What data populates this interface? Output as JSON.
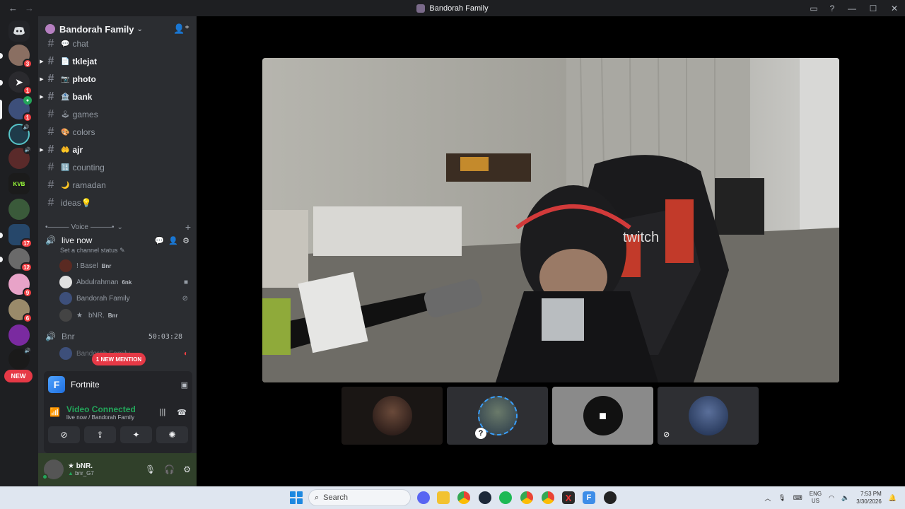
{
  "window": {
    "title": "Bandorah Family"
  },
  "guild": {
    "name": "Bandorah Family"
  },
  "channels": [
    {
      "label": "chat",
      "emoji": "💬",
      "unread": false,
      "has_arrow": false
    },
    {
      "label": "tklejat",
      "emoji": "📄",
      "unread": true,
      "has_arrow": true
    },
    {
      "label": "photo",
      "emoji": "📷",
      "unread": true,
      "has_arrow": true
    },
    {
      "label": "bank",
      "emoji": "🏦",
      "unread": true,
      "has_arrow": true
    },
    {
      "label": "games",
      "emoji": "🕹",
      "unread": false,
      "has_arrow": false
    },
    {
      "label": "colors",
      "emoji": "🎨",
      "unread": false,
      "has_arrow": false
    },
    {
      "label": "ajr",
      "emoji": "🤲",
      "unread": true,
      "has_arrow": true
    },
    {
      "label": "counting",
      "emoji": "🔢",
      "unread": false,
      "has_arrow": false
    },
    {
      "label": "ramadan",
      "emoji": "🌙",
      "unread": false,
      "has_arrow": false
    },
    {
      "label": "ideas💡",
      "emoji": "",
      "unread": false,
      "has_arrow": false
    }
  ],
  "voice_category": {
    "label": "Voice"
  },
  "voice_channel": {
    "name": "live now",
    "status": "Set a channel status",
    "users": [
      {
        "name": "! Basel",
        "tag": "Bnr",
        "icon": ""
      },
      {
        "name": "Abdulrahman",
        "tag": "6nk",
        "icon": "camera-icon"
      },
      {
        "name": "Bandorah Family",
        "tag": "",
        "icon": "stream-off-icon"
      },
      {
        "name": "bNR.",
        "tag": "Bnr",
        "icon": ""
      }
    ]
  },
  "voice_channel_2": {
    "name": "Bnr",
    "timer": "50:03:28",
    "user": "Bandorah Family"
  },
  "pills": {
    "new": "NEW",
    "mention": "1 NEW MENTION"
  },
  "activity": {
    "name": "Fortnite"
  },
  "connection": {
    "status": "Video Connected",
    "location": "live now / Bandorah Family"
  },
  "user": {
    "name": "bNR.",
    "sub": "bnr_G7"
  },
  "server_badges": [
    "3",
    "1",
    "1",
    "17",
    "12",
    "9",
    "6"
  ],
  "taskbar": {
    "search_placeholder": "Search",
    "lang_top": "ENG",
    "lang_bottom": "US",
    "time": "7:53 PM",
    "date": "3/30/2026"
  },
  "colors": {
    "accent_green": "#23a55a",
    "mention_red": "#e63946",
    "sidebar": "#2b2d31"
  }
}
